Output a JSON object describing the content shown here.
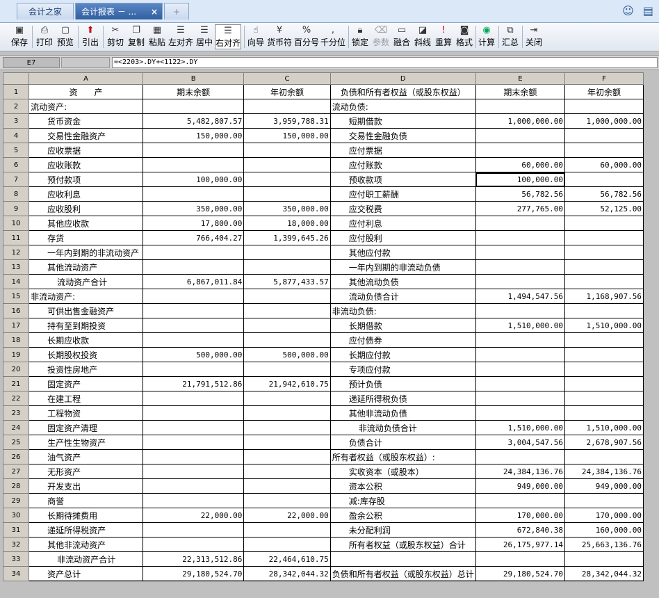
{
  "tabs": [
    {
      "label": "会计之家"
    },
    {
      "label": "会计报表 － ...",
      "close": "×"
    },
    {
      "label": "+"
    }
  ],
  "toolbar": [
    "保存",
    "打印",
    "预览",
    "引出",
    "剪切",
    "复制",
    "粘贴",
    "左对齐",
    "居中",
    "右对齐",
    "向导",
    "货币符",
    "百分号",
    "千分位",
    "锁定",
    "参数",
    "融合",
    "斜线",
    "重算",
    "格式",
    "计算",
    "汇总",
    "关闭"
  ],
  "formula": {
    "cell": "E7",
    "text": "=<2203>.DY+<1122>.DY"
  },
  "columns": [
    "A",
    "B",
    "C",
    "D",
    "E",
    "F"
  ],
  "rows": [
    [
      "1",
      "资　　产",
      "期末余额",
      "年初余额",
      "负债和所有者权益（或股东权益）",
      "期末余额",
      "年初余额"
    ],
    [
      "2",
      "流动资产:",
      "",
      "",
      "流动负债:",
      "",
      ""
    ],
    [
      "3",
      "货币资金",
      "5,482,807.57",
      "3,959,788.31",
      "短期借款",
      "1,000,000.00",
      "1,000,000.00"
    ],
    [
      "4",
      "交易性金融资产",
      "150,000.00",
      "150,000.00",
      "交易性金融负债",
      "",
      ""
    ],
    [
      "5",
      "应收票据",
      "",
      "",
      "应付票据",
      "",
      ""
    ],
    [
      "6",
      "应收账款",
      "",
      "",
      "应付账款",
      "60,000.00",
      "60,000.00"
    ],
    [
      "7",
      "预付款项",
      "100,000.00",
      "",
      "预收款项",
      "100,000.00",
      ""
    ],
    [
      "8",
      "应收利息",
      "",
      "",
      "应付职工薪酬",
      "56,782.56",
      "56,782.56"
    ],
    [
      "9",
      "应收股利",
      "350,000.00",
      "350,000.00",
      "应交税费",
      "277,765.00",
      "52,125.00"
    ],
    [
      "10",
      "其他应收款",
      "17,800.00",
      "18,000.00",
      "应付利息",
      "",
      ""
    ],
    [
      "11",
      "存货",
      "766,404.27",
      "1,399,645.26",
      "应付股利",
      "",
      ""
    ],
    [
      "12",
      "一年内到期的非流动资产",
      "",
      "",
      "其他应付款",
      "",
      ""
    ],
    [
      "13",
      "其他流动资产",
      "",
      "",
      "一年内到期的非流动负债",
      "",
      ""
    ],
    [
      "14",
      "流动资产合计",
      "6,867,011.84",
      "5,877,433.57",
      "其他流动负债",
      "",
      ""
    ],
    [
      "15",
      "非流动资产:",
      "",
      "",
      "流动负债合计",
      "1,494,547.56",
      "1,168,907.56"
    ],
    [
      "16",
      "可供出售金融资产",
      "",
      "",
      "非流动负债:",
      "",
      ""
    ],
    [
      "17",
      "持有至到期投资",
      "",
      "",
      "长期借款",
      "1,510,000.00",
      "1,510,000.00"
    ],
    [
      "18",
      "长期应收款",
      "",
      "",
      "应付债券",
      "",
      ""
    ],
    [
      "19",
      "长期股权投资",
      "500,000.00",
      "500,000.00",
      "长期应付款",
      "",
      ""
    ],
    [
      "20",
      "投资性房地产",
      "",
      "",
      "专项应付款",
      "",
      ""
    ],
    [
      "21",
      "固定资产",
      "21,791,512.86",
      "21,942,610.75",
      "预计负债",
      "",
      ""
    ],
    [
      "22",
      "在建工程",
      "",
      "",
      "递延所得税负债",
      "",
      ""
    ],
    [
      "23",
      "工程物资",
      "",
      "",
      "其他非流动负债",
      "",
      ""
    ],
    [
      "24",
      "固定资产清理",
      "",
      "",
      "非流动负债合计",
      "1,510,000.00",
      "1,510,000.00"
    ],
    [
      "25",
      "生产性生物资产",
      "",
      "",
      "负债合计",
      "3,004,547.56",
      "2,678,907.56"
    ],
    [
      "26",
      "油气资产",
      "",
      "",
      "所有者权益（或股东权益）:",
      "",
      ""
    ],
    [
      "27",
      "无形资产",
      "",
      "",
      "实收资本（或股本）",
      "24,384,136.76",
      "24,384,136.76"
    ],
    [
      "28",
      "开发支出",
      "",
      "",
      "资本公积",
      "949,000.00",
      "949,000.00"
    ],
    [
      "29",
      "商誉",
      "",
      "",
      "减:库存股",
      "",
      ""
    ],
    [
      "30",
      "长期待摊费用",
      "22,000.00",
      "22,000.00",
      "盈余公积",
      "170,000.00",
      "170,000.00"
    ],
    [
      "31",
      "递延所得税资产",
      "",
      "",
      "未分配利润",
      "672,840.38",
      "160,000.00"
    ],
    [
      "32",
      "其他非流动资产",
      "",
      "",
      "所有者权益（或股东权益）合计",
      "26,175,977.14",
      "25,663,136.76"
    ],
    [
      "33",
      "非流动资产合计",
      "22,313,512.86",
      "22,464,610.75",
      "",
      "",
      ""
    ],
    [
      "34",
      "资产总计",
      "29,180,524.70",
      "28,342,044.32",
      "负债和所有者权益（或股东权益）总计",
      "29,180,524.70",
      "28,342,044.32"
    ]
  ]
}
